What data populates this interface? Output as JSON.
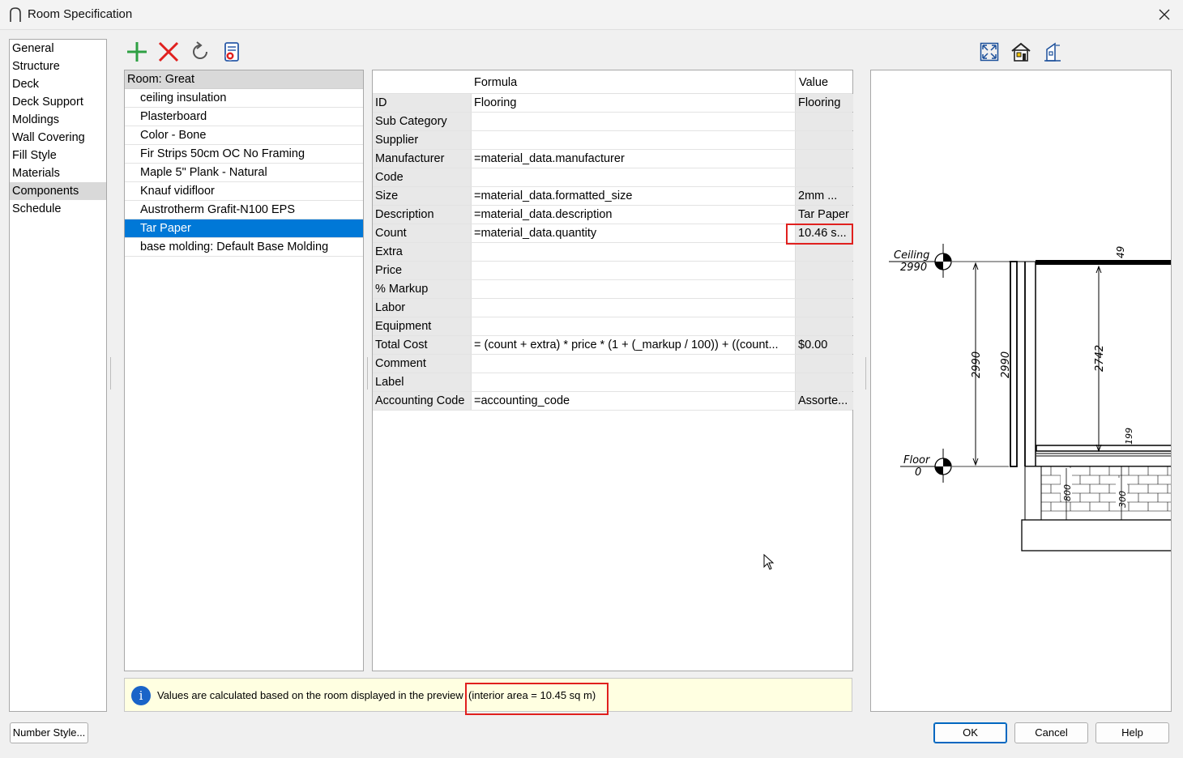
{
  "window": {
    "title": "Room Specification"
  },
  "nav": {
    "items": [
      {
        "label": "General"
      },
      {
        "label": "Structure"
      },
      {
        "label": "Deck"
      },
      {
        "label": "Deck Support"
      },
      {
        "label": "Moldings"
      },
      {
        "label": "Wall Covering"
      },
      {
        "label": "Fill Style"
      },
      {
        "label": "Materials"
      },
      {
        "label": "Components"
      },
      {
        "label": "Schedule"
      }
    ],
    "active": "Components"
  },
  "components": {
    "header": "Room: Great",
    "items": [
      {
        "label": "ceiling insulation"
      },
      {
        "label": "Plasterboard"
      },
      {
        "label": "Color - Bone"
      },
      {
        "label": "Fir Strips 50cm OC No Framing"
      },
      {
        "label": "Maple 5\" Plank - Natural"
      },
      {
        "label": "Knauf vidifloor"
      },
      {
        "label": "Austrotherm Grafit-N100 EPS"
      },
      {
        "label": "Tar Paper"
      },
      {
        "label": "base molding: Default Base Molding"
      }
    ],
    "selected": "Tar Paper"
  },
  "grid": {
    "columns": {
      "formula": "Formula",
      "value": "Value"
    },
    "rows": [
      {
        "name": "ID",
        "formula": "Flooring",
        "value": "Flooring"
      },
      {
        "name": "Sub Category",
        "formula": "",
        "value": ""
      },
      {
        "name": "Supplier",
        "formula": "",
        "value": ""
      },
      {
        "name": "Manufacturer",
        "formula": "=material_data.manufacturer",
        "value": ""
      },
      {
        "name": "Code",
        "formula": "",
        "value": ""
      },
      {
        "name": "Size",
        "formula": "=material_data.formatted_size",
        "value": "2mm ..."
      },
      {
        "name": "Description",
        "formula": "=material_data.description",
        "value": "Tar Paper"
      },
      {
        "name": "Count",
        "formula": "=material_data.quantity",
        "value": "10.46 s..."
      },
      {
        "name": "Extra",
        "formula": "",
        "value": ""
      },
      {
        "name": "Price",
        "formula": "",
        "value": ""
      },
      {
        "name": "% Markup",
        "formula": "",
        "value": ""
      },
      {
        "name": "Labor",
        "formula": "",
        "value": ""
      },
      {
        "name": "Equipment",
        "formula": "",
        "value": ""
      },
      {
        "name": "Total Cost",
        "formula": "= (count + extra) * price * (1 + (_markup / 100)) + ((count...",
        "value": "$0.00"
      },
      {
        "name": "Comment",
        "formula": "",
        "value": ""
      },
      {
        "name": "Label",
        "formula": "",
        "value": ""
      },
      {
        "name": "Accounting Code",
        "formula": "=accounting_code",
        "value": "Assorte..."
      }
    ]
  },
  "info": {
    "text": "Values are calculated based on the room displayed in the preview",
    "area": "(interior area = 10.45 sq m)"
  },
  "preview": {
    "ceiling_label": "Ceiling",
    "ceiling_value": "2990",
    "floor_label": "Floor",
    "floor_value": "0",
    "dims": {
      "top": "49",
      "left_height": "2990",
      "wall_height": "2990",
      "interior_height": "2742",
      "floor_thickness": "199",
      "foundation_left": "800",
      "foundation_right": "300"
    }
  },
  "buttons": {
    "number_style": "Number Style...",
    "ok": "OK",
    "cancel": "Cancel",
    "help": "Help"
  }
}
